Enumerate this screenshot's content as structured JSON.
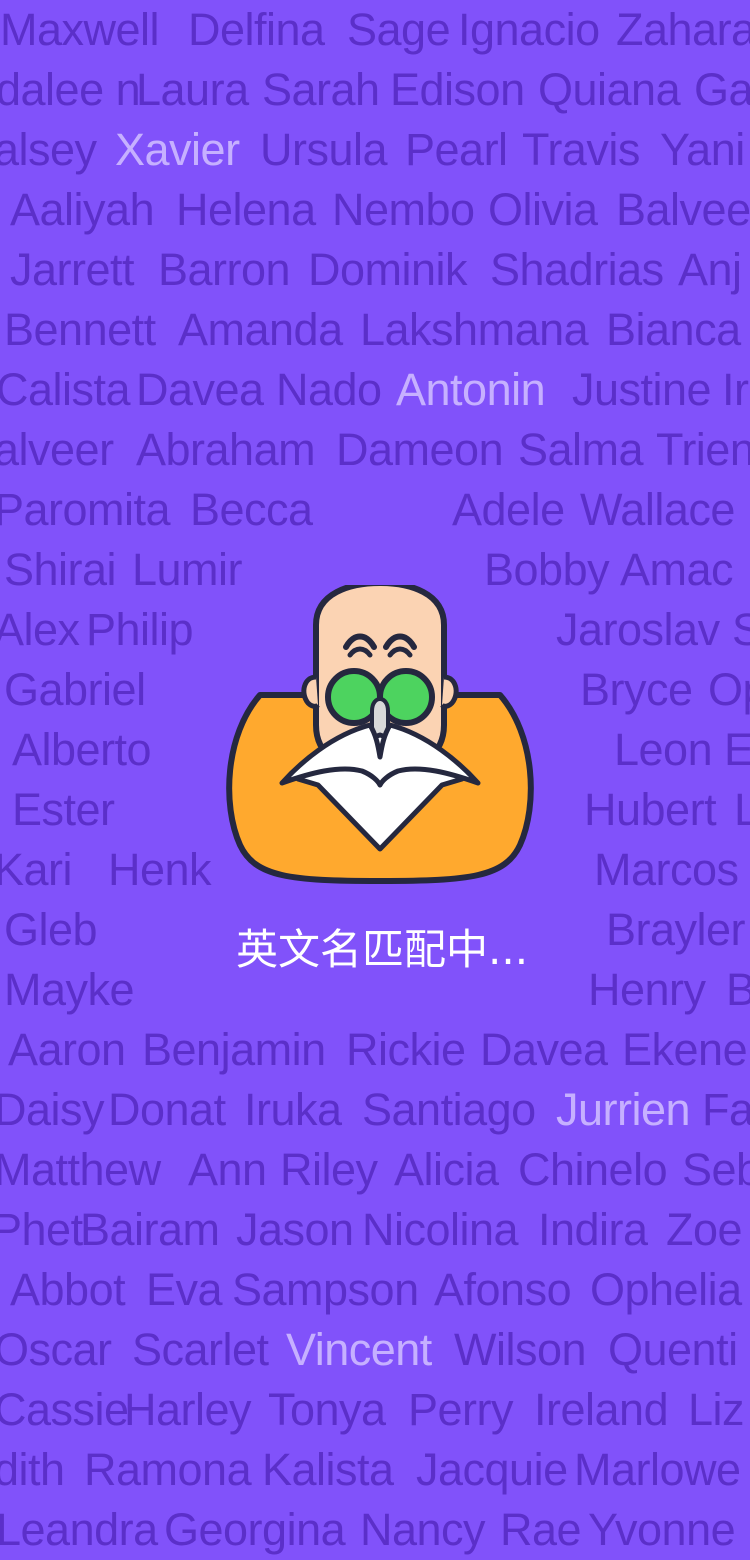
{
  "loading": {
    "text": "英文名匹配中..."
  },
  "colors": {
    "background": "#8152FA",
    "name_text": "#5B2FC9",
    "highlight_text": "#C6B0FF",
    "loading_text": "#FFFFFF",
    "robe": "#FFA92E",
    "glasses": "#4DD35F"
  },
  "icons": {
    "mascot": "bald-old-master-with-glasses-and-white-beard"
  },
  "name_rows": [
    [
      "Maxwell",
      "Delfina",
      "Sage",
      "Ignacio",
      "Zahara"
    ],
    [
      "dalee n",
      "Laura",
      "Sarah",
      "Edison",
      "Quiana",
      "Ga"
    ],
    [
      "alsey",
      "Xavier",
      "Ursula",
      "Pearl",
      "Travis",
      "Yani"
    ],
    [
      "Aaliyah",
      "Helena",
      "Nembo",
      "Olivia",
      "Balvee"
    ],
    [
      "Jarrett",
      "Barron",
      "Dominik",
      "Shadrias",
      "Anj"
    ],
    [
      "Bennett",
      "Amanda",
      "Lakshmana",
      "Bianca"
    ],
    [
      "Calista",
      "Davea",
      "Nado",
      "Antonin",
      "Justine",
      "Ir"
    ],
    [
      "alveer",
      "Abraham",
      "Dameon",
      "Salma",
      "Trien"
    ],
    [
      "Paromita",
      "Becca",
      "Adele",
      "Wallace"
    ],
    [
      "Shirai",
      "Lumir",
      "Bobby",
      "Amac"
    ],
    [
      "Alex",
      "Philip",
      "Jaroslav",
      "S"
    ],
    [
      "Gabriel",
      "Bryce",
      "Op"
    ],
    [
      "Alberto",
      "Leon",
      "E"
    ],
    [
      "Ester",
      "Hubert",
      "L"
    ],
    [
      "Kari",
      "Henk",
      "Marcos"
    ],
    [
      "Gleb",
      "Brayler"
    ],
    [
      "Mayke",
      "Henry",
      "B"
    ],
    [
      "Aaron",
      "Benjamin",
      "Rickie",
      "Davea",
      "Ekene"
    ],
    [
      "Daisy",
      "Donat",
      "Iruka",
      "Santiago",
      "Jurrien",
      "Fa"
    ],
    [
      "Matthew",
      "Ann",
      "Riley",
      "Alicia",
      "Chinelo",
      "Seb"
    ],
    [
      "Phet",
      "Bairam",
      "Jason",
      "Nicolina",
      "Indira",
      "Zoe"
    ],
    [
      "Abbot",
      "Eva",
      "Sampson",
      "Afonso",
      "Ophelia"
    ],
    [
      "Oscar",
      "Scarlet",
      "Vincent",
      "Wilson",
      "Quenti"
    ],
    [
      "Cassie",
      "Harley",
      "Tonya",
      "Perry",
      "Ireland",
      "Liz"
    ],
    [
      "dith",
      "Ramona",
      "Kalista",
      "Jacquie",
      "Marlowe"
    ],
    [
      "Leandra",
      "Georgina",
      "Nancy",
      "Rae",
      "Yvonne"
    ]
  ]
}
